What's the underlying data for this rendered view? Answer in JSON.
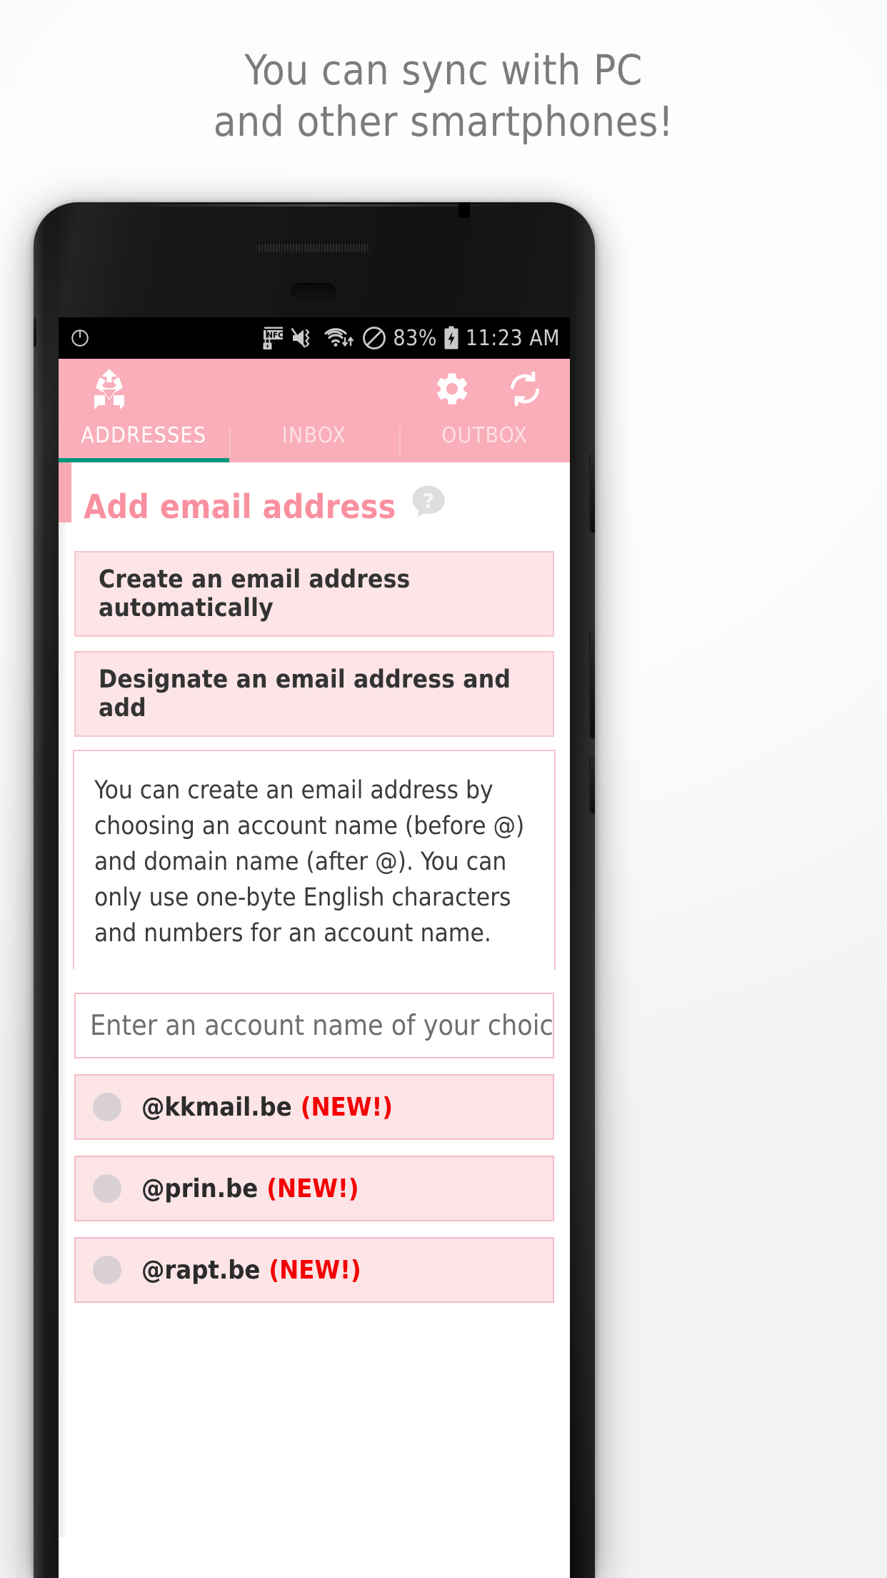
{
  "headline": {
    "line1": "You can sync with PC",
    "line2": "and other smartphones!"
  },
  "statusbar": {
    "icons": [
      "power-icon",
      "nfc-lock-icon",
      "volume-mute-vibrate-icon",
      "wifi-data-icon",
      "do-not-disturb-icon"
    ],
    "battery_percent": "83%",
    "battery_icon": "battery-charging-icon",
    "time": "11:23 AM"
  },
  "appbar": {
    "logo_icon": "recycle-mail-logo-icon",
    "settings_icon": "gear-icon",
    "sync_icon": "refresh-sync-icon",
    "accent_color": "#f9aeb9",
    "indicator_color": "#00967d",
    "tabs": [
      {
        "label": "ADDRESSES",
        "active": true
      },
      {
        "label": "INBOX",
        "active": false
      },
      {
        "label": "OUTBOX",
        "active": false
      }
    ]
  },
  "main": {
    "section_title": "Add email address",
    "section_title_color": "#f9909f",
    "help_icon": "help-question-icon",
    "options": [
      {
        "label": "Create an email address automatically"
      },
      {
        "label": "Designate an email address and add"
      }
    ],
    "info_text": "You can create an email address by choosing an account name (before @) and domain name (after @). You can only use one-byte English characters and numbers for an account name.",
    "account_input": {
      "value": "",
      "placeholder": "Enter an account name of your choice"
    },
    "domains": [
      {
        "domain": "@kkmail.be",
        "badge": "(NEW!)",
        "selected": false
      },
      {
        "domain": "@prin.be",
        "badge": "(NEW!)",
        "selected": false
      },
      {
        "domain": "@rapt.be",
        "badge": "(NEW!)",
        "selected": false
      }
    ],
    "badge_color": "#f40000"
  }
}
